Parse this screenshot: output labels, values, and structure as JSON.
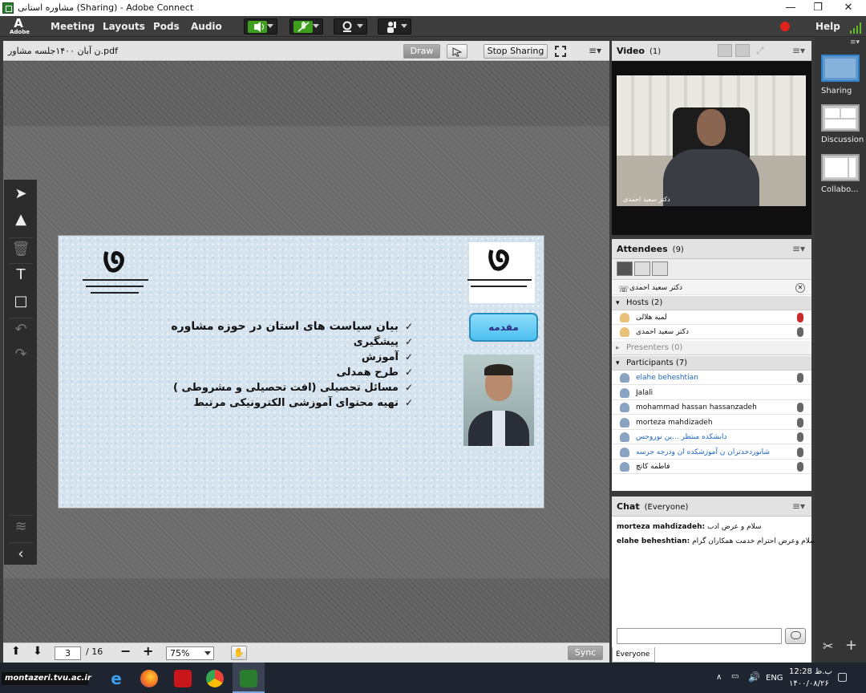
{
  "window": {
    "title": "مشاوره استانی (Sharing) - Adobe Connect",
    "minimize": "—",
    "maximize": "❐",
    "close": "✕"
  },
  "menubar": {
    "logo_text": "Adobe",
    "items": [
      "Meeting",
      "Layouts",
      "Pods",
      "Audio"
    ],
    "help": "Help"
  },
  "share": {
    "filename": "ن آبان ۱۴۰۰جلسه مشاور.pdf",
    "draw_label": "Draw",
    "stop_sharing_label": "Stop Sharing",
    "slide": {
      "intro_button": "مقدمه",
      "bullets": [
        "بیان سیاست های استان در حوزه مشاوره",
        "پیشگیری",
        "آموزش",
        "طرح همدلی",
        "مسائل تحصیلی (افت تحصیلی  و مشروطی )",
        "تهیه محتوای آموزشی الکترونیکی مرتبط"
      ]
    },
    "footer": {
      "page_current": "3",
      "page_total": "/ 16",
      "zoom": "75%",
      "sync_label": "Sync"
    }
  },
  "video_pod": {
    "title": "Video",
    "count": "(1)",
    "speaker_label": "دکتر سعید احمدی"
  },
  "attendees_pod": {
    "title": "Attendees",
    "count": "(9)",
    "speaking": "دکتر سعید احمدی",
    "hosts_label": "Hosts (2)",
    "hosts": [
      "لمیه هلالی",
      "دکتر سعید احمدی"
    ],
    "presenters_label": "Presenters (0)",
    "participants_label": "Participants (7)",
    "participants": [
      "elahe beheshtian",
      "Jalali",
      "mohammad hassan hassanzadeh",
      "morteza mahdizadeh",
      "دانشکده منتظر ...ین نوروحس",
      "شابوردخدتران ن آموزشکده ان ودرجه جرسه",
      "فاطمه کاتچ"
    ]
  },
  "chat_pod": {
    "title": "Chat",
    "scope": "(Everyone)",
    "messages": [
      {
        "sender": "morteza mahdizadeh:",
        "text": "سلام و عرض ادب"
      },
      {
        "sender": "elahe beheshtian:",
        "text": "با سلام وعرض احترام خدمت همکاران گرام"
      }
    ],
    "tab_label": "Everyone"
  },
  "layouts_rail": {
    "items": [
      "Sharing",
      "Discussion",
      "Collabo..."
    ]
  },
  "taskbar": {
    "watermark": "montazeri.tvu.ac.ir",
    "lang": "ENG",
    "time": "12:28 ب.ظ",
    "date": "۱۴۰۰/۰۸/۲۶"
  },
  "colors": {
    "accent": "#2f7fc7",
    "record": "#e0241b",
    "audio_active": "#3e9f1e"
  }
}
